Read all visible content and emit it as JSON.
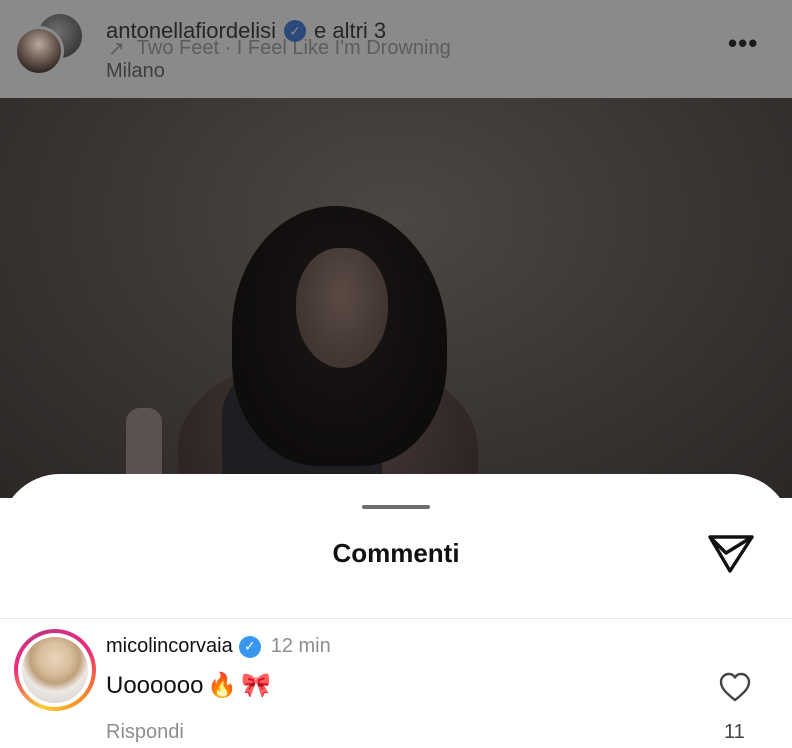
{
  "post_header": {
    "username": "antonellafiordelisi",
    "collaborators": "e altri 3",
    "audio": "Two Feet · I Feel Like I'm Drowning",
    "location": "Milano",
    "icons": {
      "more": "more-options-icon",
      "audio_arrow": "trending-arrow-icon",
      "verified": "verified-badge-icon"
    }
  },
  "comments_sheet": {
    "title": "Commenti",
    "share_icon": "paper-plane-icon",
    "comments": [
      {
        "username": "micolincorvaia",
        "time": "12 min",
        "text": "Uoooooo",
        "emojis": [
          "fire-emoji",
          "ribbon-emoji"
        ],
        "reply_label": "Rispondi",
        "likes": "11"
      }
    ]
  },
  "colors": {
    "overlay_gray": "#8a8a8a",
    "verified_blue": "#3897f0",
    "secondary_text": "#8e8e8e",
    "story_ring": [
      "#f9ce34",
      "#ee2a7b",
      "#c13584"
    ]
  }
}
